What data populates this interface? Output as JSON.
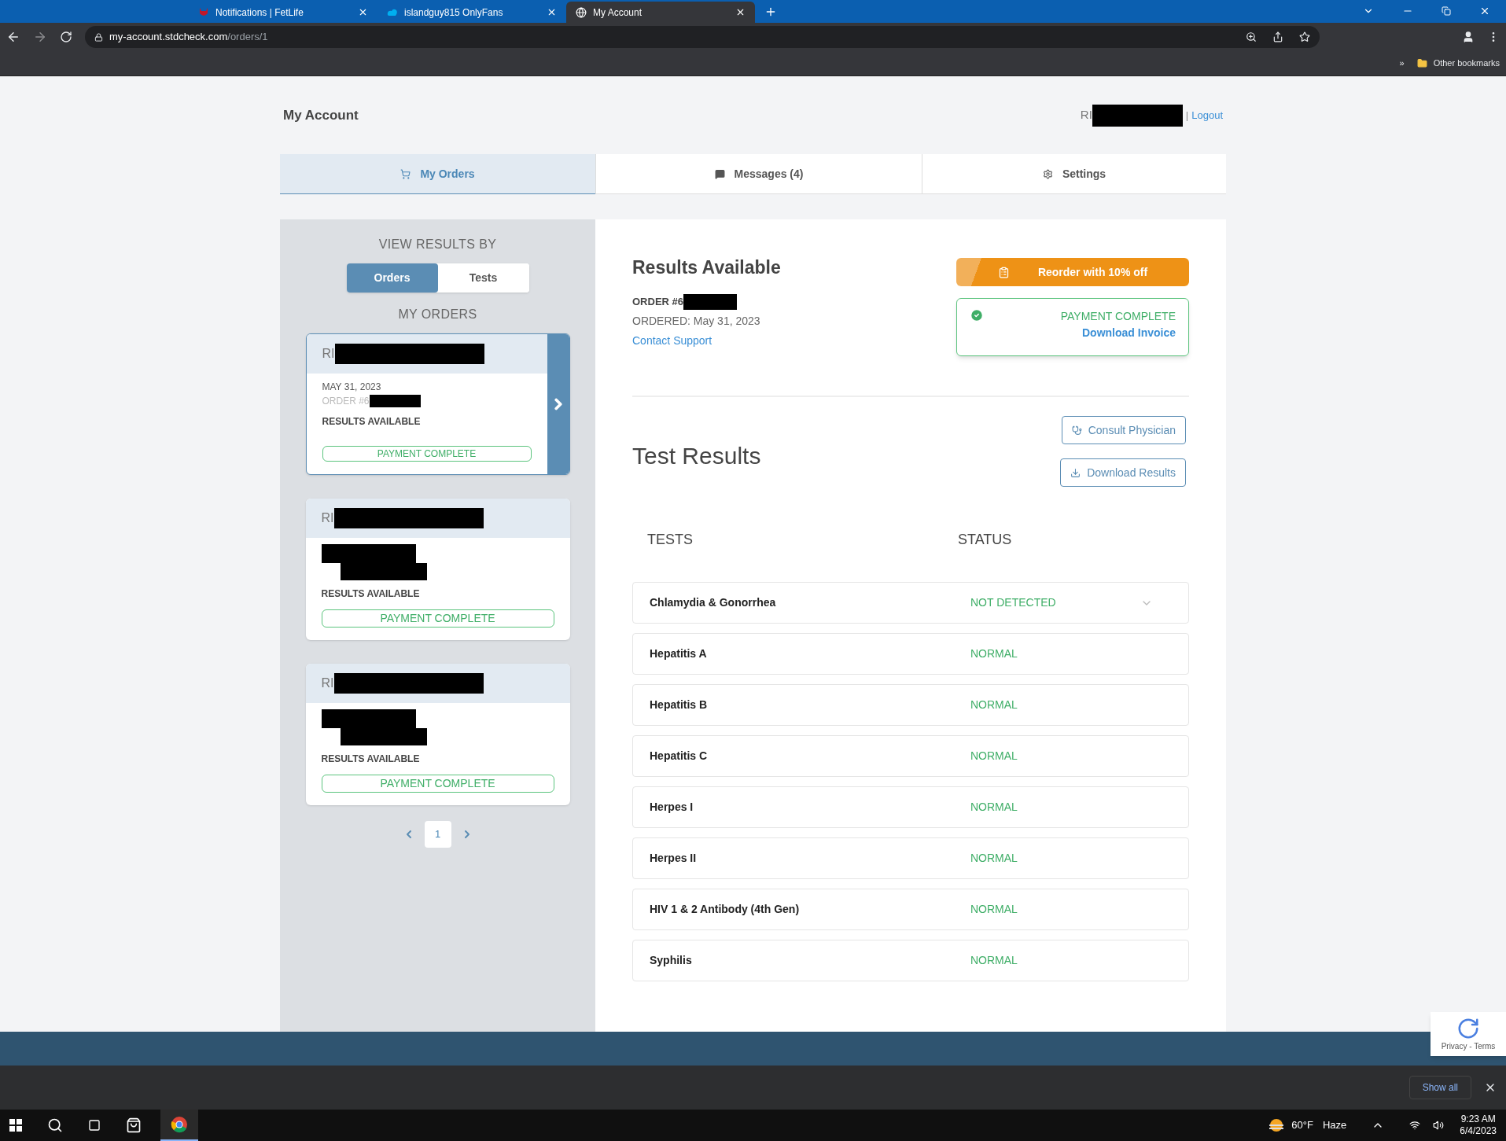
{
  "browser": {
    "tabs": [
      {
        "title": "Notifications | FetLife",
        "selected": false,
        "kind": "devil"
      },
      {
        "title": "islandguy815 OnlyFans",
        "selected": false,
        "kind": "cloud"
      },
      {
        "title": "My Account",
        "selected": true,
        "kind": "globe"
      }
    ],
    "url_host": "my-account.stdcheck.com",
    "url_path": "/orders/1",
    "bookmarks_chevron": "»",
    "bookmark": "Other bookmarks"
  },
  "page": {
    "title": "My Account",
    "user": "RI",
    "logout": "Logout",
    "separator": "|",
    "nav_tabs": [
      {
        "label": "My Orders",
        "selected": true
      },
      {
        "label": "Messages (4)",
        "selected": false
      },
      {
        "label": "Settings",
        "selected": false
      }
    ],
    "sidebar": {
      "heading": "VIEW RESULTS BY",
      "toggle": [
        {
          "label": "Orders",
          "selected": true
        },
        {
          "label": "Tests",
          "selected": false
        }
      ],
      "orders_heading": "MY ORDERS",
      "orders": [
        {
          "name": "RI",
          "date": "MAY 31, 2023",
          "order": "ORDER #6",
          "status": "RESULTS AVAILABLE",
          "payment": "PAYMENT COMPLETE",
          "selected": true
        },
        {
          "name": "RI",
          "status": "RESULTS AVAILABLE",
          "payment": "PAYMENT COMPLETE",
          "selected": false
        },
        {
          "name": "RI",
          "status": "RESULTS AVAILABLE",
          "payment": "PAYMENT COMPLETE",
          "selected": false
        }
      ],
      "pages": [
        {
          "label": "1",
          "selected": true
        }
      ]
    },
    "order": {
      "title": "Results Available",
      "number": "ORDER #6",
      "ordered": "ORDERED: May 31, 2023",
      "support": "Contact Support",
      "reorder": "Reorder with 10% off",
      "payment": "PAYMENT COMPLETE",
      "invoice": "Download Invoice"
    },
    "results": {
      "title": "Test Results",
      "consult": "Consult Physician",
      "download": "Download Results",
      "columns": [
        "TESTS",
        "STATUS"
      ],
      "rows": [
        {
          "test": "Chlamydia & Gonorrhea",
          "status": "NOT DETECTED",
          "expandable": true
        },
        {
          "test": "Hepatitis A",
          "status": "NORMAL",
          "expandable": false
        },
        {
          "test": "Hepatitis B",
          "status": "NORMAL",
          "expandable": false
        },
        {
          "test": "Hepatitis C",
          "status": "NORMAL",
          "expandable": false
        },
        {
          "test": "Herpes I",
          "status": "NORMAL",
          "expandable": false
        },
        {
          "test": "Herpes II",
          "status": "NORMAL",
          "expandable": false
        },
        {
          "test": "HIV 1 & 2 Antibody (4th Gen)",
          "status": "NORMAL",
          "expandable": false
        },
        {
          "test": "Syphilis",
          "status": "NORMAL",
          "expandable": false
        }
      ]
    },
    "recaptcha": "Privacy - Terms"
  },
  "downloads": {
    "show_all": "Show all"
  },
  "taskbar": {
    "temperature": "60°F",
    "weather": "Haze",
    "time": "9:23 AM",
    "date": "6/4/2023"
  }
}
